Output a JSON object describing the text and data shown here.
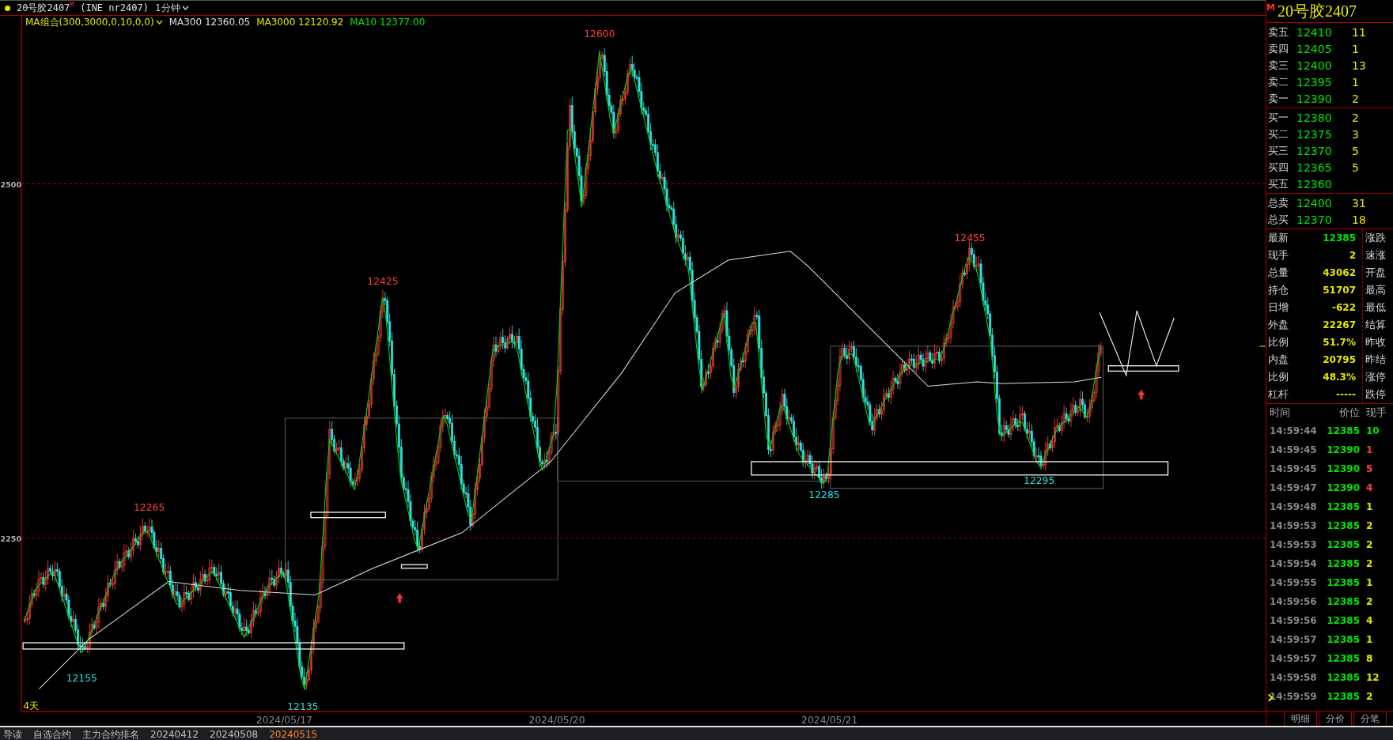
{
  "header": {
    "title": "20号胶2407",
    "badge": "M",
    "exchange": "(INE nr2407)",
    "period": "1分钟"
  },
  "indicators": [
    {
      "text": "MA组合(300,3000,0,10,0,0)",
      "color": "#e6e600",
      "dropdown": true
    },
    {
      "text": "MA300 12360.05",
      "color": "#e0e0e0",
      "dropdown": false
    },
    {
      "text": "MA3000 12120.92",
      "color": "#e6e600",
      "dropdown": false
    },
    {
      "text": "MA10 12377.00",
      "color": "#00e600",
      "dropdown": false
    }
  ],
  "chart": {
    "y_labels": [
      "2500",
      "2250"
    ],
    "price_labels": [
      {
        "text": "12600",
        "kind": "high"
      },
      {
        "text": "12425",
        "kind": "high"
      },
      {
        "text": "12265",
        "kind": "high"
      },
      {
        "text": "12455",
        "kind": "high"
      },
      {
        "text": "12155",
        "kind": "low"
      },
      {
        "text": "12135",
        "kind": "low"
      },
      {
        "text": "12285",
        "kind": "low"
      },
      {
        "text": "12295",
        "kind": "low"
      }
    ],
    "span_label": "4天",
    "dates": [
      "2024/05/17",
      "2024/05/20",
      "2024/05/21"
    ]
  },
  "quote": {
    "badge": "M",
    "title": "20号胶2407",
    "asks": [
      {
        "label": "卖五",
        "price": "12410",
        "volume": "11"
      },
      {
        "label": "卖四",
        "price": "12405",
        "volume": "1"
      },
      {
        "label": "卖三",
        "price": "12400",
        "volume": "13"
      },
      {
        "label": "卖二",
        "price": "12395",
        "volume": "1"
      },
      {
        "label": "卖一",
        "price": "12390",
        "volume": "2"
      }
    ],
    "bids": [
      {
        "label": "买一",
        "price": "12380",
        "volume": "2"
      },
      {
        "label": "买二",
        "price": "12375",
        "volume": "3"
      },
      {
        "label": "买三",
        "price": "12370",
        "volume": "5"
      },
      {
        "label": "买四",
        "price": "12365",
        "volume": "5"
      },
      {
        "label": "买五",
        "price": "12360"
      }
    ],
    "totals": [
      {
        "label": "总卖",
        "price": "12400",
        "volume": "31"
      },
      {
        "label": "总买",
        "price": "12370",
        "volume": "18"
      }
    ],
    "stats": [
      {
        "label": "最新",
        "value": "12385",
        "color": "#00e600"
      },
      {
        "label": "现手",
        "value": "2",
        "color": "#e6e600"
      },
      {
        "label": "总量",
        "value": "43062",
        "color": "#e6e600"
      },
      {
        "label": "持仓",
        "value": "51707",
        "color": "#e6e600"
      },
      {
        "label": "日增",
        "value": "-622",
        "color": "#e6e600"
      },
      {
        "label": "外盘",
        "value": "22267",
        "color": "#e6e600"
      },
      {
        "label": "比例",
        "value": "51.7%",
        "color": "#e6e600"
      },
      {
        "label": "内盘",
        "value": "20795",
        "color": "#e6e600"
      },
      {
        "label": "比例",
        "value": "48.3%",
        "color": "#e6e600"
      },
      {
        "label": "杠杆",
        "value": "-----",
        "color": "#e6e600"
      }
    ],
    "side_labels": [
      "涨跌",
      "速涨",
      "开盘",
      "最高",
      "最低",
      "结算",
      "昨收",
      "昨结",
      "涨停",
      "跌停"
    ],
    "tick_columns": [
      "时间",
      "价位",
      "现手"
    ],
    "ticks": [
      {
        "time": "14:59:44",
        "price": "12385",
        "volume": "10",
        "color": "#00e600",
        "selected": false
      },
      {
        "time": "14:59:45",
        "price": "12390",
        "volume": "1",
        "color": "#ff4040",
        "selected": false
      },
      {
        "time": "14:59:45",
        "price": "12390",
        "volume": "5",
        "color": "#ff4040",
        "selected": false
      },
      {
        "time": "14:59:47",
        "price": "12390",
        "volume": "4",
        "color": "#ff4040",
        "selected": false
      },
      {
        "time": "14:59:48",
        "price": "12385",
        "volume": "1",
        "color": "#e6e600",
        "selected": false
      },
      {
        "time": "14:59:53",
        "price": "12385",
        "volume": "2",
        "color": "#e6e600",
        "selected": false
      },
      {
        "time": "14:59:53",
        "price": "12385",
        "volume": "2",
        "color": "#e6e600",
        "selected": false
      },
      {
        "time": "14:59:54",
        "price": "12385",
        "volume": "2",
        "color": "#e6e600",
        "selected": false
      },
      {
        "time": "14:59:55",
        "price": "12385",
        "volume": "1",
        "color": "#e6e600",
        "selected": false
      },
      {
        "time": "14:59:56",
        "price": "12385",
        "volume": "2",
        "color": "#e6e600",
        "selected": false
      },
      {
        "time": "14:59:56",
        "price": "12385",
        "volume": "4",
        "color": "#e6e600",
        "selected": false
      },
      {
        "time": "14:59:57",
        "price": "12385",
        "volume": "1",
        "color": "#e6e600",
        "selected": false
      },
      {
        "time": "14:59:57",
        "price": "12385",
        "volume": "8",
        "color": "#e6e600",
        "selected": false
      },
      {
        "time": "14:59:58",
        "price": "12385",
        "volume": "12",
        "color": "#e6e600",
        "selected": false
      },
      {
        "time": "14:59:59",
        "price": "12385",
        "volume": "2",
        "color": "#e6e600",
        "selected": true
      }
    ],
    "tabs": [
      "明细",
      "分价",
      "分笔"
    ]
  },
  "bottom_bar": [
    {
      "text": "导读",
      "selected": false
    },
    {
      "text": "自选合约",
      "selected": false
    },
    {
      "text": "主力合约排名",
      "selected": false
    },
    {
      "text": "20240412",
      "selected": false
    },
    {
      "text": "20240508",
      "selected": false
    },
    {
      "text": "20240515",
      "selected": true
    }
  ]
}
